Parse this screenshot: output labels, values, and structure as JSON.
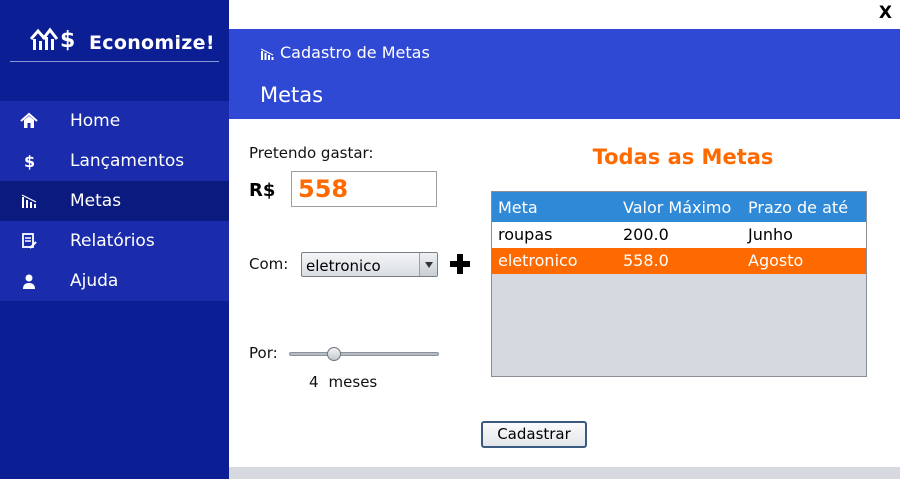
{
  "app": {
    "brand": "Economize!",
    "close_label": "X"
  },
  "sidebar": {
    "items": [
      {
        "label": "Home",
        "icon": "home-icon"
      },
      {
        "label": "Lançamentos",
        "icon": "dollar-icon"
      },
      {
        "label": "Metas",
        "icon": "goals-chart-icon"
      },
      {
        "label": "Relatórios",
        "icon": "report-icon"
      },
      {
        "label": "Ajuda",
        "icon": "user-icon"
      }
    ],
    "active_index": 2
  },
  "header": {
    "breadcrumb": "Cadastro de Metas",
    "title": "Metas"
  },
  "form": {
    "spend_label": "Pretendo gastar:",
    "currency": "R$",
    "amount": "558",
    "category_label": "Com:",
    "category_value": "eletronico",
    "period_label": "Por:",
    "months_value": 4,
    "months_count": "4",
    "months_unit": "meses",
    "slider_max": 12,
    "submit_label": "Cadastrar"
  },
  "goals": {
    "title": "Todas as Metas",
    "columns": [
      "Meta",
      "Valor Máximo",
      "Prazo de até"
    ],
    "rows": [
      {
        "meta": "roupas",
        "valor": "200.0",
        "prazo": "Junho"
      },
      {
        "meta": "eletronico",
        "valor": "558.0",
        "prazo": "Agosto"
      }
    ],
    "selected_row": 1
  },
  "colors": {
    "sidebar": "#0c1e93",
    "header": "#3049d5",
    "accent": "#ff6a00",
    "table_header": "#2f89d7"
  }
}
